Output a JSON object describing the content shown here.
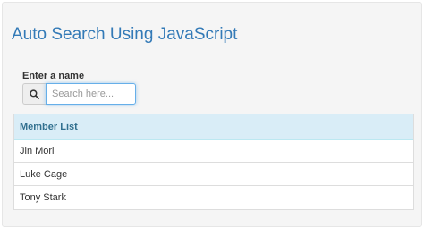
{
  "page": {
    "title": "Auto Search Using JavaScript"
  },
  "form": {
    "label": "Enter a name",
    "search_icon": "search-icon",
    "search_placeholder": "Search here...",
    "search_value": ""
  },
  "table": {
    "header": "Member List",
    "rows": [
      "Jin Mori",
      "Luke Cage",
      "Tony Stark"
    ]
  },
  "colors": {
    "title": "#337ab7",
    "header_bg": "#d9edf7",
    "header_text": "#31708f",
    "input_focus": "#66afe9"
  }
}
